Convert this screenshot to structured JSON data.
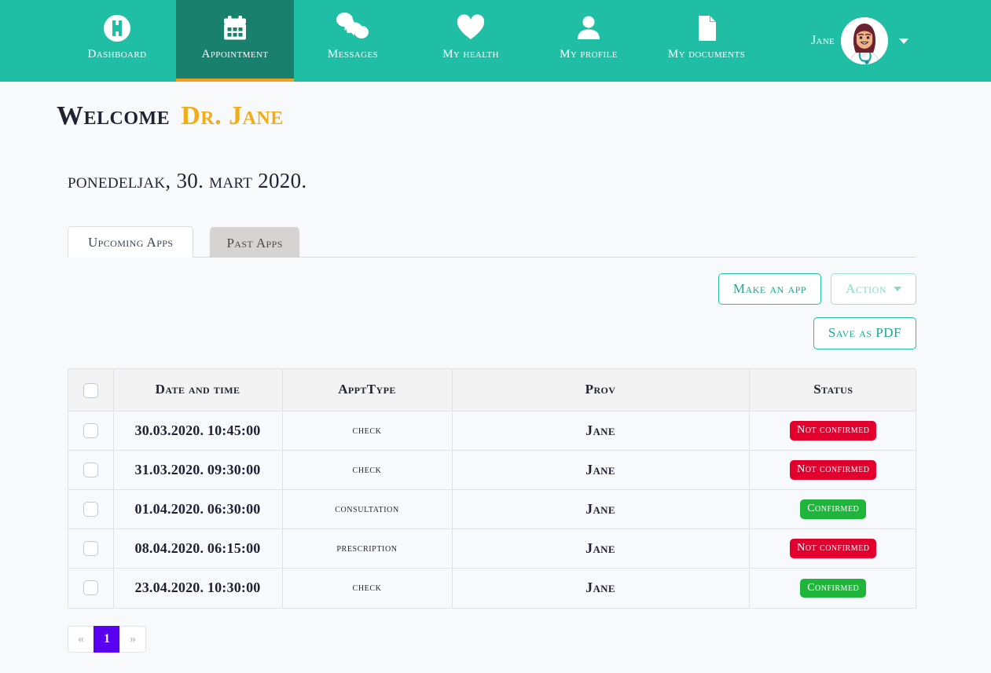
{
  "theme": {
    "nav_teal": "#20bfa5",
    "nav_teal_active": "#18806d",
    "nav_active_underline": "#f0a020",
    "accent_orange": "#f0ac1b",
    "button_teal": "#20bfa5",
    "badge_danger": "#e3002f",
    "badge_success": "#1eb53a",
    "pagination_active": "#5a00f0",
    "page_background": "#f8f9fb"
  },
  "nav": {
    "items": [
      {
        "label": "Dashboard",
        "icon": "hospital-icon",
        "active": false
      },
      {
        "label": "Appointment",
        "icon": "calendar-icon",
        "active": true
      },
      {
        "label": "Messages",
        "icon": "chat-icon",
        "active": false
      },
      {
        "label": "My health",
        "icon": "heart-icon",
        "active": false
      },
      {
        "label": "My profile",
        "icon": "user-icon",
        "active": false
      },
      {
        "label": "My documents",
        "icon": "document-icon",
        "active": false
      }
    ],
    "user": {
      "name": "Jane",
      "avatar_alt": "doctor-avatar",
      "caret": "chevron-down-icon"
    }
  },
  "header": {
    "welcome_text": "Welcome",
    "doctor_name": "Dr. Jane",
    "date_line": "ponedeljak, 30. mart 2020."
  },
  "tabs": [
    {
      "label": "Upcoming Apps",
      "active": true
    },
    {
      "label": "Past Apps",
      "active": false
    }
  ],
  "toolbar": {
    "make_app_label": "Make an app",
    "action_label": "Action",
    "save_pdf_label": "Save as PDF"
  },
  "table": {
    "columns": [
      "",
      "Date and time",
      "ApptType",
      "Prov",
      "Status"
    ],
    "rows": [
      {
        "date": "30.03.2020. 10:45:00",
        "type": "check",
        "prov": "Jane",
        "status": "Not confirmed",
        "status_kind": "danger"
      },
      {
        "date": "31.03.2020. 09:30:00",
        "type": "check",
        "prov": "Jane",
        "status": "Not confirmed",
        "status_kind": "danger"
      },
      {
        "date": "01.04.2020. 06:30:00",
        "type": "consultation",
        "prov": "Jane",
        "status": "Confirmed",
        "status_kind": "success"
      },
      {
        "date": "08.04.2020. 06:15:00",
        "type": "prescription",
        "prov": "Jane",
        "status": "Not confirmed",
        "status_kind": "danger"
      },
      {
        "date": "23.04.2020. 10:30:00",
        "type": "check",
        "prov": "Jane",
        "status": "Confirmed",
        "status_kind": "success"
      }
    ]
  },
  "pagination": {
    "prev": "«",
    "next": "»",
    "pages": [
      "1"
    ],
    "current": "1"
  }
}
